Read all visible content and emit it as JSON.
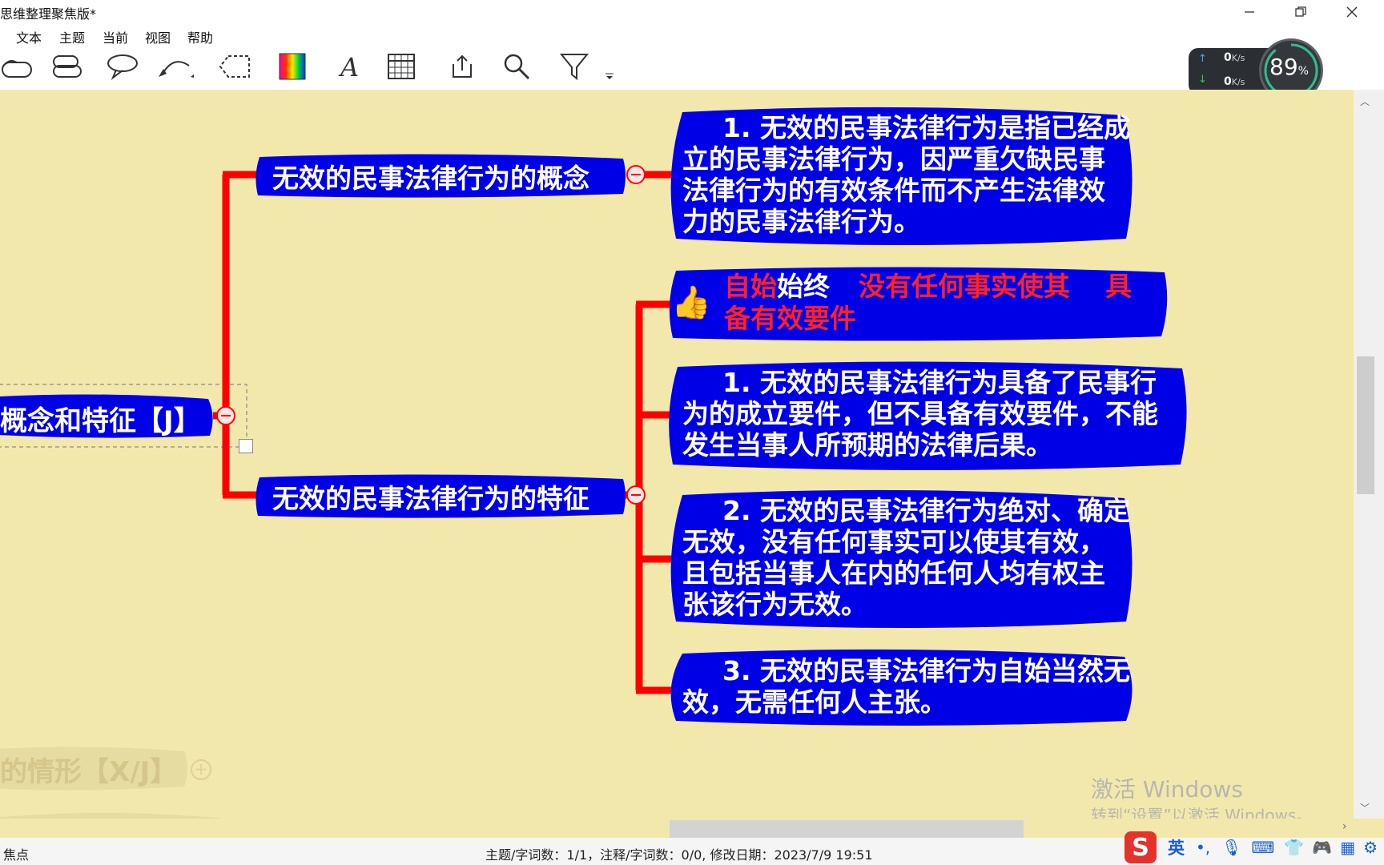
{
  "window": {
    "title": "思维整理聚焦版*",
    "min_icon": "minimize-icon",
    "restore_icon": "restore-icon",
    "close_icon": "close-icon"
  },
  "menu": [
    "文本",
    "主题",
    "当前",
    "视图",
    "帮助"
  ],
  "toolbar": {
    "icons": [
      "topic-shape-icon",
      "callout-bubbles-icon",
      "speech-bubble-icon",
      "relationship-arrows-icon",
      "boundary-icon",
      "color-palette-icon",
      "text-format-icon",
      "table-icon",
      "export-icon",
      "search-icon",
      "filter-icon",
      "overflow-icon"
    ]
  },
  "net": {
    "upload": "0",
    "upload_unit": "K/s",
    "download": "0",
    "download_unit": "K/s",
    "percent": "89",
    "percent_unit": "%"
  },
  "mindmap": {
    "root": "概念和特征【J】",
    "branch1": {
      "label": "无效的民事法律行为的概念",
      "detail": "1. 无效的民事法律行为是指已经成立的民事法律行为，因严重欠缺民事法律行为的有效条件而不产生法律效力的民事法律行为。"
    },
    "branch2": {
      "label": "无效的民事法律行为的特征",
      "highlight": {
        "part1": "自始",
        "part2": "始终",
        "part3": "没有任何事实使其",
        "part4": "具",
        "part5": "备有效要件"
      },
      "items": [
        "1. 无效的民事法律行为具备了民事行为的成立要件，但不具备有效要件，不能发生当事人所预期的法律后果。",
        "2. 无效的民事法律行为绝对、确定无效，没有任何事实可以使其有效，且包括当事人在内的任何人均有权主张该行为无效。",
        "3. 无效的民事法律行为自始当然无效，无需任何人主张。"
      ]
    },
    "faded_node": "的情形【X/J】"
  },
  "watermark": {
    "line1": "激活 Windows",
    "line2": "转到“设置”以激活 Windows。"
  },
  "status": {
    "left": "焦点",
    "info": "主题/字词数：1/1，注释/字词数：0/0, 修改日期：2023/7/9 19:51"
  },
  "tray": {
    "ime": "英"
  },
  "colors": {
    "node_blue": "#0000e6",
    "branch_red": "#ff0000",
    "canvas": "#f3e8ac",
    "highlight_red": "#ff2222"
  }
}
